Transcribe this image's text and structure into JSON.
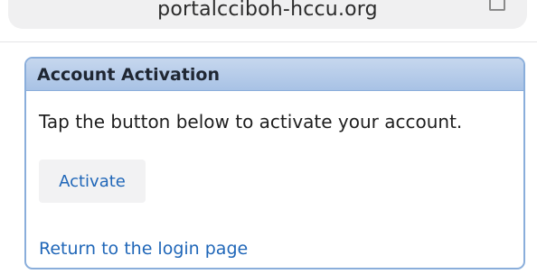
{
  "browser": {
    "url_text": "portalcciboh-hccu.org"
  },
  "panel": {
    "title": "Account Activation",
    "instruction": "Tap the button below to activate your account.",
    "activate_label": "Activate",
    "login_link_label": "Return to the login page"
  },
  "colors": {
    "header_bg": "#b7cdea",
    "border": "#8aaedb",
    "link": "#1f66b8",
    "button_bg": "#f2f2f3"
  }
}
